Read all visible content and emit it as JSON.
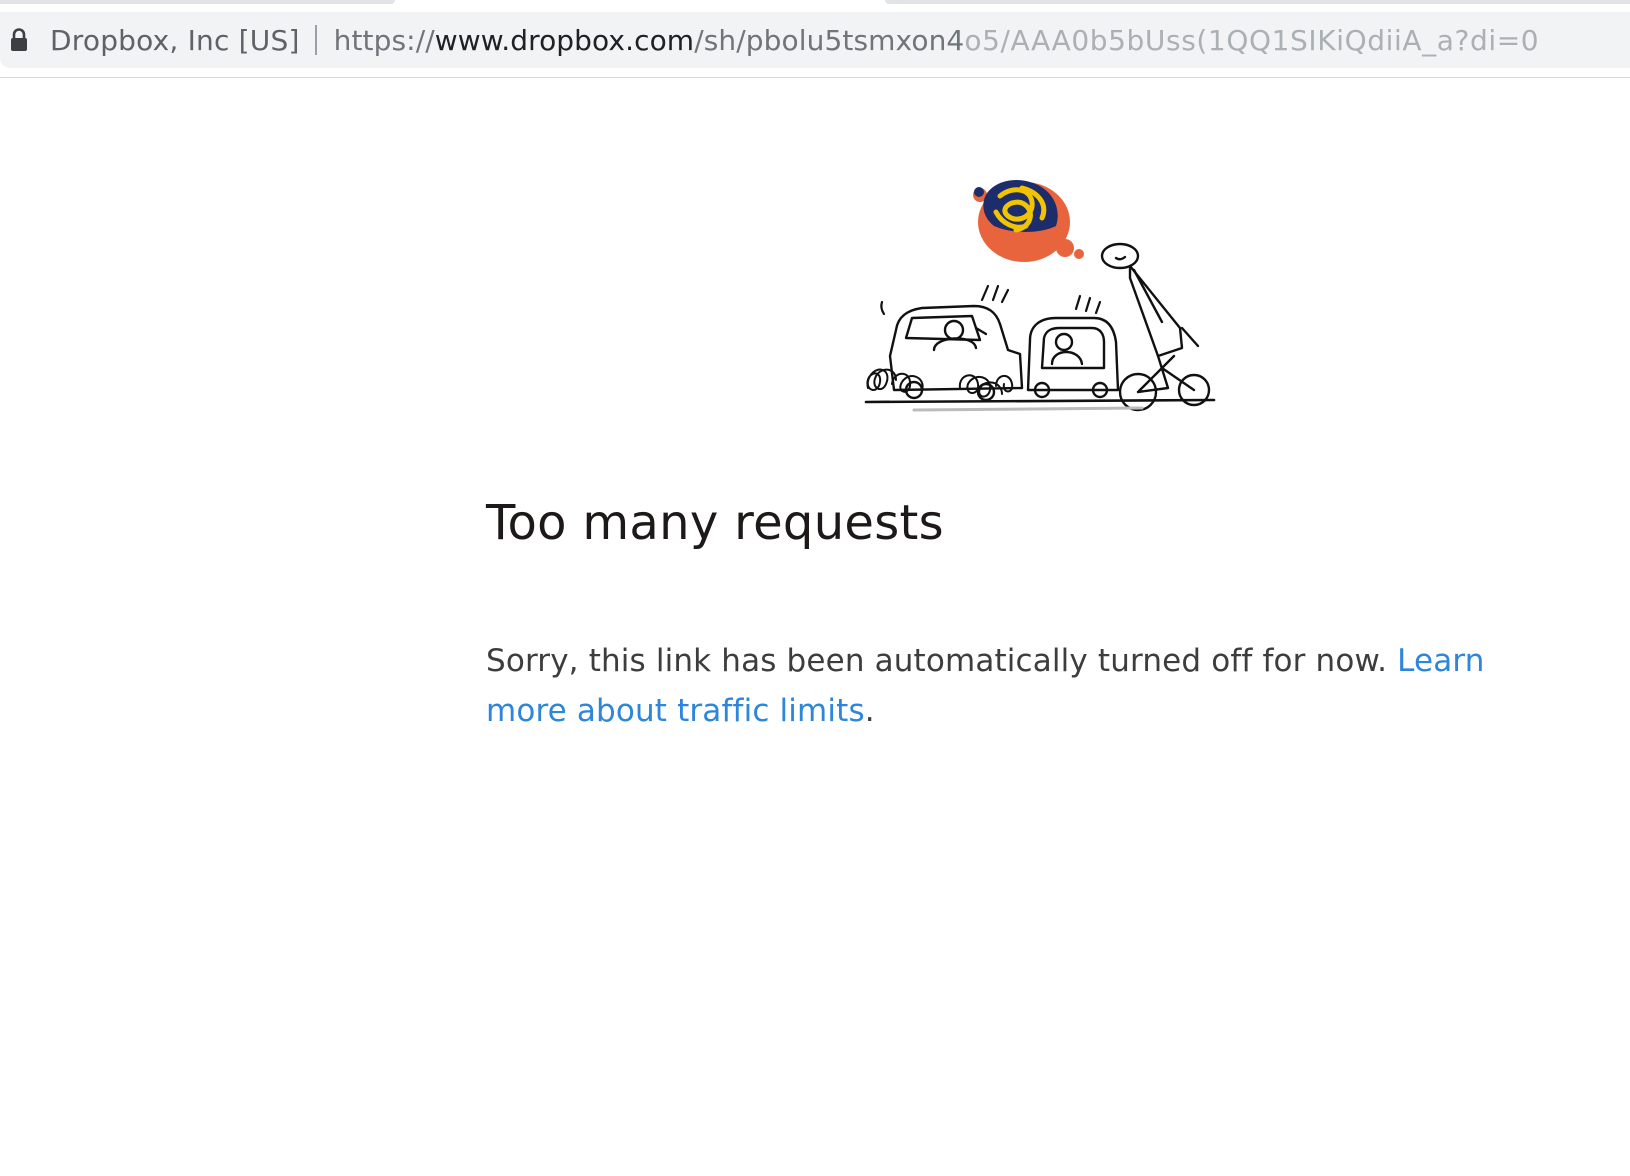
{
  "browser": {
    "tab_strip_visible": true,
    "site_identity": "Dropbox, Inc [US]",
    "url": {
      "scheme": "https://",
      "host": "www.dropbox.com",
      "path": "/sh/pbolu5tsmxon4",
      "obscured_tail": "o5/AAA0b5bUss(1QQ1SIKiQdiiA_a?di=0"
    },
    "lock_icon": "lock-icon"
  },
  "page": {
    "illustration": "traffic-jam-illustration",
    "title": "Too many requests",
    "message": "Sorry, this link has been automatically turned off for now. ",
    "link_text": "Learn more about traffic limits",
    "after_link": ".",
    "colors": {
      "link": "#2d86d9",
      "title": "#1e1919",
      "body": "#3d3d3d",
      "balloon_orange": "#e8643c",
      "balloon_blue": "#1d2c6b",
      "balloon_yellow": "#f2c400"
    }
  }
}
